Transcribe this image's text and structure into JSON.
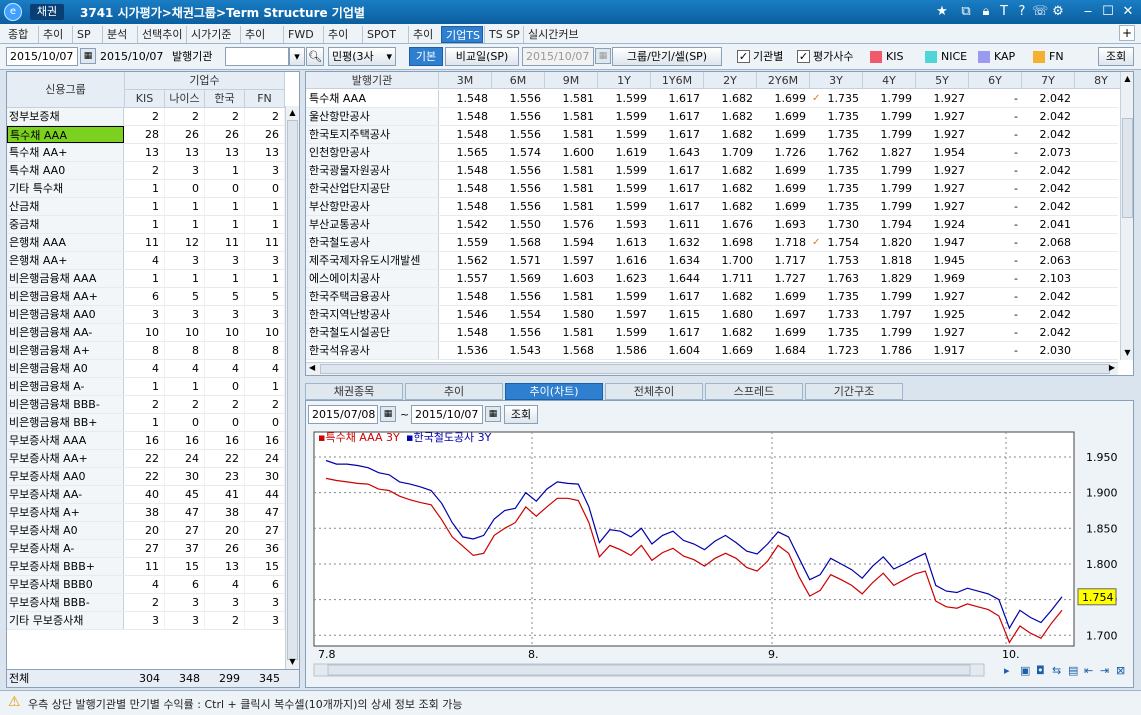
{
  "titlebar": {
    "badge": "채권",
    "title": "3741 시가평가>채권그룹>Term Structure 기업별",
    "icons": [
      "star-icon",
      "window-icon",
      "lock-icon",
      "text-icon",
      "help-icon",
      "phone-icon",
      "settings-icon",
      "minimize-icon",
      "maximize-icon",
      "close-icon"
    ]
  },
  "menu": {
    "tabs": [
      "종합",
      "추이",
      "SP",
      "분석",
      "선택추이",
      "시가기준",
      "추이",
      "FWD",
      "추이",
      "SPOT",
      "추이",
      "기업TS",
      "TS SP",
      "실시간커브"
    ],
    "active_index": 11,
    "plus": "+"
  },
  "toolbar": {
    "date_from": "2015/10/07",
    "date_to": "2015/10/07",
    "issuer_label": "발행기관",
    "issuer_value": "",
    "rating_select": "민평(3사",
    "btn_basic": "기본",
    "btn_compare": "비교일(SP)",
    "compare_date": "2015/10/07",
    "btn_group": "그룹/만기/셀(SP)",
    "chk_issuer": "기관별",
    "chk_rating": "평가사수",
    "legend": [
      {
        "name": "KIS",
        "color": "#f05a6a"
      },
      {
        "name": "NICE",
        "color": "#4fd6d6"
      },
      {
        "name": "KAP",
        "color": "#9a9af0"
      },
      {
        "name": "FN",
        "color": "#f5b030"
      }
    ],
    "btn_query": "조회"
  },
  "left": {
    "header_group": "신용그룹",
    "header_count": "기업수",
    "cols": [
      "KIS",
      "나이스",
      "한국",
      "FN"
    ],
    "selected_index": 1,
    "rows": [
      {
        "name": "정부보증채",
        "v": [
          2,
          2,
          2,
          2
        ]
      },
      {
        "name": "특수채 AAA",
        "v": [
          28,
          26,
          26,
          26
        ]
      },
      {
        "name": "특수채 AA+",
        "v": [
          13,
          13,
          13,
          13
        ]
      },
      {
        "name": "특수채 AA0",
        "v": [
          2,
          3,
          1,
          3
        ]
      },
      {
        "name": "기타 특수채",
        "v": [
          1,
          0,
          0,
          0
        ]
      },
      {
        "name": "산금채",
        "v": [
          1,
          1,
          1,
          1
        ]
      },
      {
        "name": "중금채",
        "v": [
          1,
          1,
          1,
          1
        ]
      },
      {
        "name": "은행채 AAA",
        "v": [
          11,
          12,
          11,
          11
        ]
      },
      {
        "name": "은행채 AA+",
        "v": [
          4,
          3,
          3,
          3
        ]
      },
      {
        "name": "비은행금융채 AAA",
        "v": [
          1,
          1,
          1,
          1
        ]
      },
      {
        "name": "비은행금융채 AA+",
        "v": [
          6,
          5,
          5,
          5
        ]
      },
      {
        "name": "비은행금융채 AA0",
        "v": [
          3,
          3,
          3,
          3
        ]
      },
      {
        "name": "비은행금융채 AA-",
        "v": [
          10,
          10,
          10,
          10
        ]
      },
      {
        "name": "비은행금융채 A+",
        "v": [
          8,
          8,
          8,
          8
        ]
      },
      {
        "name": "비은행금융채 A0",
        "v": [
          4,
          4,
          4,
          4
        ]
      },
      {
        "name": "비은행금융채 A-",
        "v": [
          1,
          1,
          0,
          1
        ]
      },
      {
        "name": "비은행금융채 BBB-",
        "v": [
          2,
          2,
          2,
          2
        ]
      },
      {
        "name": "비은행금융채 BB+",
        "v": [
          1,
          0,
          0,
          0
        ]
      },
      {
        "name": "무보증사채 AAA",
        "v": [
          16,
          16,
          16,
          16
        ]
      },
      {
        "name": "무보증사채 AA+",
        "v": [
          22,
          24,
          22,
          24
        ]
      },
      {
        "name": "무보증사채 AA0",
        "v": [
          22,
          30,
          23,
          30
        ]
      },
      {
        "name": "무보증사채 AA-",
        "v": [
          40,
          45,
          41,
          44
        ]
      },
      {
        "name": "무보증사채 A+",
        "v": [
          38,
          47,
          38,
          47
        ]
      },
      {
        "name": "무보증사채 A0",
        "v": [
          20,
          27,
          20,
          27
        ]
      },
      {
        "name": "무보증사채 A-",
        "v": [
          27,
          37,
          26,
          36
        ]
      },
      {
        "name": "무보증사채 BBB+",
        "v": [
          11,
          15,
          13,
          15
        ]
      },
      {
        "name": "무보증사채 BBB0",
        "v": [
          4,
          6,
          4,
          6
        ]
      },
      {
        "name": "무보증사채 BBB-",
        "v": [
          2,
          3,
          3,
          3
        ]
      },
      {
        "name": "기타 무보증사채",
        "v": [
          3,
          3,
          2,
          3
        ]
      }
    ],
    "total_label": "전체",
    "total": [
      304,
      348,
      299,
      345
    ]
  },
  "right": {
    "cols": [
      "발행기관",
      "3M",
      "6M",
      "9M",
      "1Y",
      "1Y6M",
      "2Y",
      "2Y6M",
      "3Y",
      "4Y",
      "5Y",
      "6Y",
      "7Y",
      "8Y"
    ],
    "rows": [
      {
        "name": "특수채 AAA",
        "v": [
          "1.548",
          "1.556",
          "1.581",
          "1.599",
          "1.617",
          "1.682",
          "1.699",
          "1.735",
          "1.799",
          "1.927",
          "-",
          "2.042",
          "-"
        ],
        "mark": 7
      },
      {
        "name": "울산항만공사",
        "v": [
          "1.548",
          "1.556",
          "1.581",
          "1.599",
          "1.617",
          "1.682",
          "1.699",
          "1.735",
          "1.799",
          "1.927",
          "-",
          "2.042",
          "-"
        ]
      },
      {
        "name": "한국토지주택공사",
        "v": [
          "1.548",
          "1.556",
          "1.581",
          "1.599",
          "1.617",
          "1.682",
          "1.699",
          "1.735",
          "1.799",
          "1.927",
          "-",
          "2.042",
          "-"
        ]
      },
      {
        "name": "인천항만공사",
        "v": [
          "1.565",
          "1.574",
          "1.600",
          "1.619",
          "1.643",
          "1.709",
          "1.726",
          "1.762",
          "1.827",
          "1.954",
          "-",
          "2.073",
          "-"
        ]
      },
      {
        "name": "한국광물자원공사",
        "v": [
          "1.548",
          "1.556",
          "1.581",
          "1.599",
          "1.617",
          "1.682",
          "1.699",
          "1.735",
          "1.799",
          "1.927",
          "-",
          "2.042",
          "-"
        ]
      },
      {
        "name": "한국산업단지공단",
        "v": [
          "1.548",
          "1.556",
          "1.581",
          "1.599",
          "1.617",
          "1.682",
          "1.699",
          "1.735",
          "1.799",
          "1.927",
          "-",
          "2.042",
          "-"
        ]
      },
      {
        "name": "부산항만공사",
        "v": [
          "1.548",
          "1.556",
          "1.581",
          "1.599",
          "1.617",
          "1.682",
          "1.699",
          "1.735",
          "1.799",
          "1.927",
          "-",
          "2.042",
          "-"
        ]
      },
      {
        "name": "부산교통공사",
        "v": [
          "1.542",
          "1.550",
          "1.576",
          "1.593",
          "1.611",
          "1.676",
          "1.693",
          "1.730",
          "1.794",
          "1.924",
          "-",
          "2.041",
          "-"
        ]
      },
      {
        "name": "한국철도공사",
        "v": [
          "1.559",
          "1.568",
          "1.594",
          "1.613",
          "1.632",
          "1.698",
          "1.718",
          "1.754",
          "1.820",
          "1.947",
          "-",
          "2.068",
          "-"
        ],
        "mark": 7
      },
      {
        "name": "제주국제자유도시개발센",
        "v": [
          "1.562",
          "1.571",
          "1.597",
          "1.616",
          "1.634",
          "1.700",
          "1.717",
          "1.753",
          "1.818",
          "1.945",
          "-",
          "2.063",
          "-"
        ]
      },
      {
        "name": "에스에이치공사",
        "v": [
          "1.557",
          "1.569",
          "1.603",
          "1.623",
          "1.644",
          "1.711",
          "1.727",
          "1.763",
          "1.829",
          "1.969",
          "-",
          "2.103",
          "-"
        ]
      },
      {
        "name": "한국주택금융공사",
        "v": [
          "1.548",
          "1.556",
          "1.581",
          "1.599",
          "1.617",
          "1.682",
          "1.699",
          "1.735",
          "1.799",
          "1.927",
          "-",
          "2.042",
          "-"
        ]
      },
      {
        "name": "한국지역난방공사",
        "v": [
          "1.546",
          "1.554",
          "1.580",
          "1.597",
          "1.615",
          "1.680",
          "1.697",
          "1.733",
          "1.797",
          "1.925",
          "-",
          "2.042",
          "-"
        ]
      },
      {
        "name": "한국철도시설공단",
        "v": [
          "1.548",
          "1.556",
          "1.581",
          "1.599",
          "1.617",
          "1.682",
          "1.699",
          "1.735",
          "1.799",
          "1.927",
          "-",
          "2.042",
          "-"
        ]
      },
      {
        "name": "한국석유공사",
        "v": [
          "1.536",
          "1.543",
          "1.568",
          "1.586",
          "1.604",
          "1.669",
          "1.684",
          "1.723",
          "1.786",
          "1.917",
          "-",
          "2.030",
          "-"
        ]
      }
    ]
  },
  "lower_tabs": {
    "labels": [
      "채권종목",
      "추이",
      "추이(차트)",
      "전체추이",
      "스프레드",
      "기간구조"
    ],
    "active_index": 2
  },
  "chart_panel": {
    "date_from": "2015/07/08",
    "date_to": "2015/10/07",
    "btn_query": "조회"
  },
  "chart_data": {
    "type": "line",
    "x_labels": [
      "7.8",
      "8.",
      "9.",
      "10."
    ],
    "series": [
      {
        "name": "특수채 AAA 3Y",
        "color": "#cc0000",
        "values": [
          1.92,
          1.917,
          1.915,
          1.913,
          1.912,
          1.905,
          1.903,
          1.895,
          1.89,
          1.886,
          1.883,
          1.862,
          1.838,
          1.825,
          1.812,
          1.815,
          1.84,
          1.85,
          1.858,
          1.88,
          1.867,
          1.88,
          1.892,
          1.892,
          1.889,
          1.858,
          1.81,
          1.826,
          1.82,
          1.812,
          1.826,
          1.805,
          1.816,
          1.822,
          1.811,
          1.806,
          1.797,
          1.808,
          1.815,
          1.808,
          1.795,
          1.79,
          1.804,
          1.826,
          1.815,
          1.782,
          1.755,
          1.763,
          1.785,
          1.778,
          1.77,
          1.758,
          1.774,
          1.787,
          1.77,
          1.778,
          1.786,
          1.79,
          1.748,
          1.74,
          1.738,
          1.744,
          1.74,
          1.736,
          1.727,
          1.69,
          1.713,
          1.703,
          1.696,
          1.717,
          1.735
        ]
      },
      {
        "name": "한국철도공사 3Y",
        "color": "#0000aa",
        "values": [
          1.945,
          1.94,
          1.94,
          1.938,
          1.935,
          1.928,
          1.925,
          1.915,
          1.912,
          1.908,
          1.903,
          1.885,
          1.858,
          1.838,
          1.835,
          1.84,
          1.863,
          1.875,
          1.878,
          1.9,
          1.888,
          1.905,
          1.915,
          1.913,
          1.912,
          1.88,
          1.83,
          1.848,
          1.846,
          1.838,
          1.85,
          1.828,
          1.84,
          1.846,
          1.833,
          1.828,
          1.82,
          1.832,
          1.84,
          1.83,
          1.818,
          1.814,
          1.828,
          1.845,
          1.838,
          1.808,
          1.778,
          1.785,
          1.808,
          1.8,
          1.792,
          1.78,
          1.797,
          1.81,
          1.793,
          1.8,
          1.808,
          1.815,
          1.77,
          1.762,
          1.76,
          1.766,
          1.762,
          1.758,
          1.75,
          1.71,
          1.735,
          1.725,
          1.718,
          1.735,
          1.754
        ]
      }
    ],
    "ylim": [
      1.685,
      1.985
    ],
    "yticks": [
      "1.950",
      "1.900",
      "1.850",
      "1.800",
      "1.750",
      "1.700"
    ],
    "last_value_label": "1.754",
    "grid": true
  },
  "status": {
    "text": "우측 상단 발행기관별 만기별 수익률 : Ctrl + 클릭시 복수셀(10개까지)의 상세 정보 조회 가능"
  }
}
